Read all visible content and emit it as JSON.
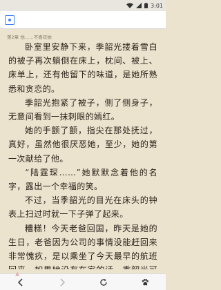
{
  "status_bar": {
    "time": "3:01"
  },
  "reader": {
    "chapter_header": "第2章 他……不喜欢她",
    "paragraphs": [
      "卧室里安静下来，季韶光搂着雪白的被子再次躺倒在床上，枕间、被上、床单上，还有他留下的味道，是她所熟悉和贪恋的。",
      "季韶光抱紧了被子，侧了侧身子，无意间看到一抹刺眼的嫣红。",
      "她的手颤了颤，指尖在那处抚过，真好，虽然他很厌恶她，至少，她的第一次献给了他。",
      "“陆霆琛……”她默默念着他的名字，露出一个幸福的笑。",
      "不过，当季韶光的目光在床头的钟表上扫过时就一下子弹了起来。",
      "糟糕！今天老爸回国，昨天是她的生日，老爸因为公司的事情没能赶回来非常愧疚，是以乘坐了今天最早的航班回来，如果她没有在家的话，季韶光可想而知老爸会怎样的难过"
    ]
  }
}
